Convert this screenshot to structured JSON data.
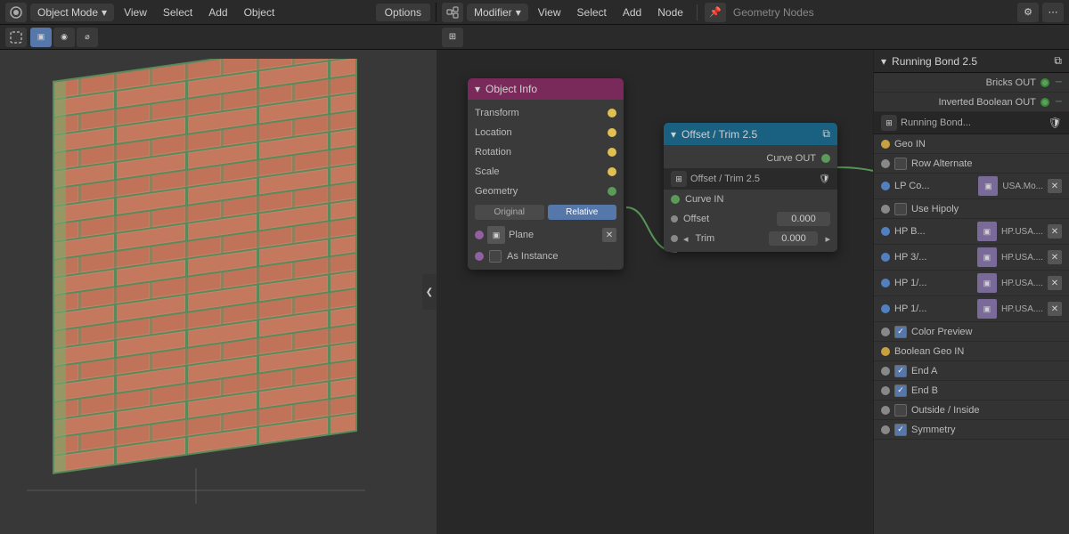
{
  "topbar": {
    "left": {
      "mode_label": "Object Mode",
      "menu_items": [
        "View",
        "Select",
        "Add",
        "Object"
      ]
    },
    "right": {
      "mode_label": "Modifier",
      "menu_items": [
        "View",
        "Select",
        "Add",
        "Node"
      ],
      "editor_label": "Geometry Nodes"
    }
  },
  "viewport": {
    "options_label": "Options",
    "collapse_icon": "❮"
  },
  "object_info_node": {
    "title": "Object Info",
    "rows": [
      {
        "label": "Transform",
        "socket_color": "yellow"
      },
      {
        "label": "Location",
        "socket_color": "yellow"
      },
      {
        "label": "Rotation",
        "socket_color": "yellow"
      },
      {
        "label": "Scale",
        "socket_color": "yellow"
      },
      {
        "label": "Geometry",
        "socket_color": "green"
      }
    ],
    "buttons": {
      "original": "Original",
      "relative": "Relative"
    },
    "plane_label": "Plane",
    "as_instance_label": "As Instance"
  },
  "offset_trim_node": {
    "title": "Offset / Trim 2.5",
    "outputs": [
      {
        "label": "Curve OUT",
        "socket_color": "green"
      }
    ],
    "sub_header": "Offset / Trim 2.5",
    "inputs": [
      {
        "label": "Curve IN",
        "socket_color": "green"
      }
    ],
    "fields": [
      {
        "label": "Offset",
        "value": "0.000"
      },
      {
        "label": "Trim",
        "value": "0.000"
      }
    ]
  },
  "running_bond_panel": {
    "title": "Running Bond 2.5",
    "outputs": [
      {
        "label": "Bricks OUT",
        "socket_color": "green",
        "connected": true
      },
      {
        "label": "Inverted Boolean OUT",
        "socket_color": "green",
        "connected": true
      }
    ],
    "sub_header": "Running Bond...",
    "rows": [
      {
        "type": "input",
        "label": "Geo IN",
        "socket_color": "yellow"
      },
      {
        "type": "checkbox",
        "label": "Row Alternate",
        "checked": false,
        "socket_color": "gray"
      },
      {
        "type": "material",
        "label": "LP Co...",
        "mat_name": "USA.Mo...",
        "socket_color": "blue",
        "has_x": true
      },
      {
        "type": "checkbox",
        "label": "Use Hipoly",
        "checked": false,
        "socket_color": "gray"
      },
      {
        "type": "material",
        "label": "HP B...",
        "mat_name": "HP.USA....",
        "socket_color": "blue",
        "has_x": true
      },
      {
        "type": "material",
        "label": "HP 3/...",
        "mat_name": "HP.USA....",
        "socket_color": "blue",
        "has_x": true
      },
      {
        "type": "material",
        "label": "HP 1/...",
        "mat_name": "HP.USA....",
        "socket_color": "blue",
        "has_x": true
      },
      {
        "type": "material",
        "label": "HP 1/...",
        "mat_name": "HP.USA....",
        "socket_color": "blue",
        "has_x": true
      },
      {
        "type": "checkbox",
        "label": "Color Preview",
        "checked": true,
        "socket_color": "gray"
      },
      {
        "type": "input",
        "label": "Boolean Geo IN",
        "socket_color": "yellow"
      },
      {
        "type": "checkbox",
        "label": "End A",
        "checked": true,
        "socket_color": "gray"
      },
      {
        "type": "checkbox",
        "label": "End B",
        "checked": true,
        "socket_color": "gray"
      },
      {
        "type": "checkbox",
        "label": "Outside / Inside",
        "checked": false,
        "socket_color": "gray"
      },
      {
        "type": "checkbox",
        "label": "Symmetry",
        "checked": true,
        "socket_color": "gray"
      }
    ]
  },
  "icons": {
    "chevron_down": "▾",
    "chevron_right": "▸",
    "close": "✕",
    "check": "✓",
    "node_icon": "⊞",
    "material_icon": "▣",
    "shield_icon": "🛡",
    "copy_icon": "⧉",
    "left_arrow": "◂",
    "right_arrow": "▸"
  },
  "colors": {
    "socket_green": "#5da05d",
    "socket_yellow": "#c8a040",
    "socket_gray": "#888888",
    "socket_blue": "#5080c0",
    "socket_purple": "#9060a0",
    "node_object_info_header": "#7a2a5a",
    "node_offset_trim_header": "#1a6080",
    "accent_blue": "#5577aa",
    "running_bond_header": "#2a2a2a"
  }
}
